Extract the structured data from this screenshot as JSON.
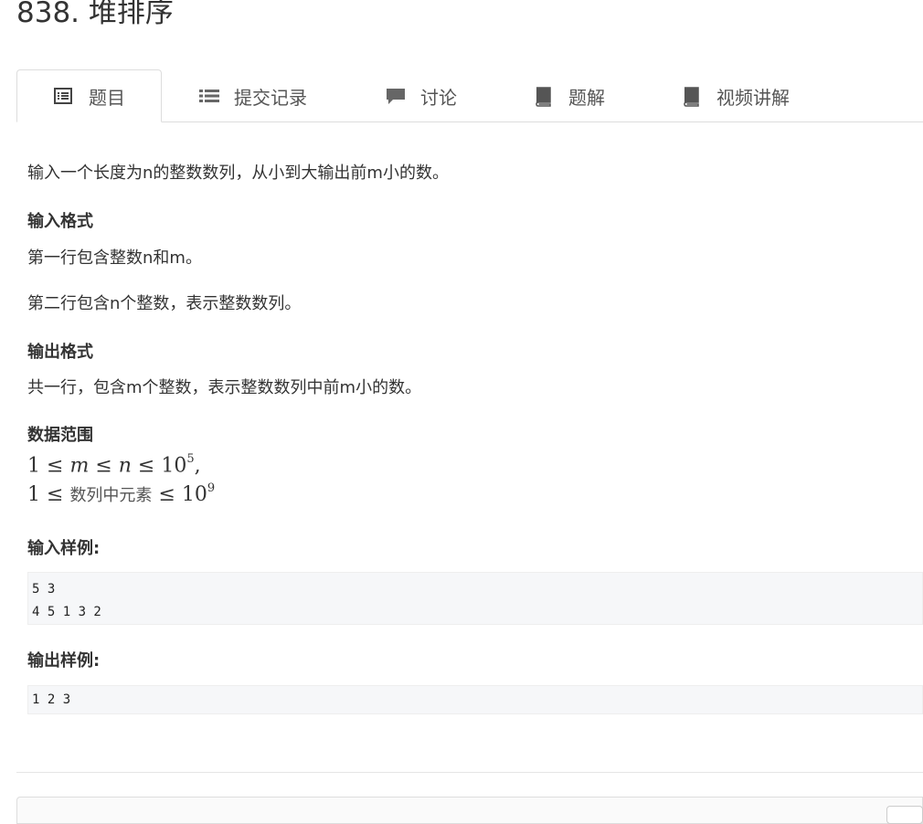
{
  "problem": {
    "title": "838. 堆排序"
  },
  "tabs": [
    {
      "label": "题目",
      "icon": "list-alt-icon"
    },
    {
      "label": "提交记录",
      "icon": "list-icon"
    },
    {
      "label": "讨论",
      "icon": "comment-icon"
    },
    {
      "label": "题解",
      "icon": "book-icon"
    },
    {
      "label": "视频讲解",
      "icon": "book-icon"
    }
  ],
  "description": {
    "intro": "输入一个长度为n的整数数列，从小到大输出前m小的数。",
    "input_format_heading": "输入格式",
    "input_line1": "第一行包含整数n和m。",
    "input_line2": "第二行包含n个整数，表示整数数列。",
    "output_format_heading": "输出格式",
    "output_line1": "共一行，包含m个整数，表示整数数列中前m小的数。",
    "range_heading": "数据范围",
    "range_line1": {
      "one": "1",
      "le": "≤",
      "m": "m",
      "n": "n",
      "ten": "10",
      "exp": "5",
      "comma": ","
    },
    "range_line2": {
      "one": "1",
      "le": "≤",
      "text": "数列中元素",
      "ten": "10",
      "exp": "9"
    },
    "sample_input_heading": "输入样例:",
    "sample_input": "5 3\n4 5 1 3 2",
    "sample_output_heading": "输出样例:",
    "sample_output": "1 2 3"
  }
}
